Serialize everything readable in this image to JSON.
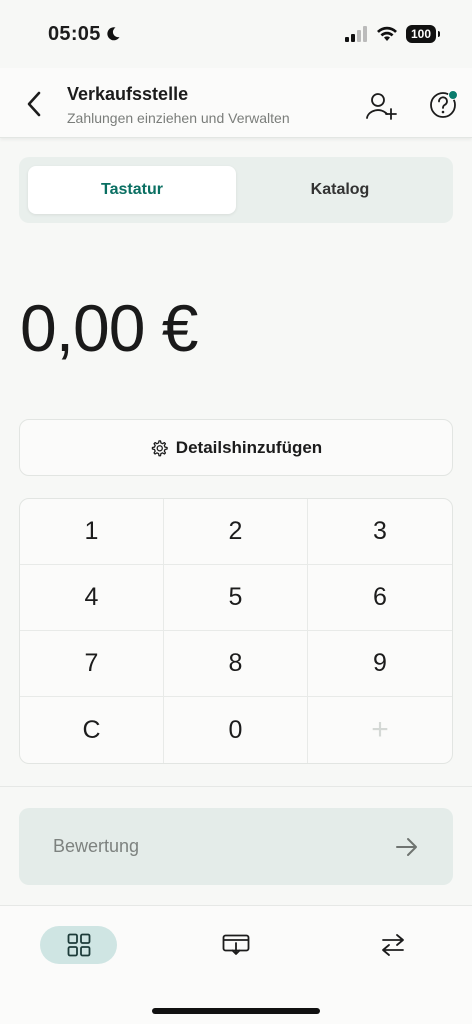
{
  "status_bar": {
    "time": "05:05",
    "battery": "100",
    "icons": [
      "moon-icon",
      "cellular-signal-icon",
      "wifi-icon",
      "battery-icon"
    ]
  },
  "header": {
    "title": "Verkaufsstelle",
    "subtitle": "Zahlungen einziehen und Verwalten",
    "icons": [
      "back-chevron-icon",
      "add-user-icon",
      "help-icon"
    ]
  },
  "tabs": {
    "items": [
      {
        "label": "Tastatur",
        "active": true
      },
      {
        "label": "Katalog",
        "active": false
      }
    ]
  },
  "amount": "0,00 €",
  "details_button": {
    "label": "Detailshinzufügen",
    "icon": "gear-icon"
  },
  "keypad": {
    "keys": [
      "1",
      "2",
      "3",
      "4",
      "5",
      "6",
      "7",
      "8",
      "9",
      "C",
      "0",
      "+"
    ]
  },
  "submit_button": {
    "label": "Bewertung",
    "icon": "arrow-right-icon"
  },
  "bottom_nav": {
    "items": [
      {
        "icon": "grid-icon",
        "active": true
      },
      {
        "icon": "card-reader-icon",
        "active": false
      },
      {
        "icon": "transfer-arrows-icon",
        "active": false
      }
    ]
  },
  "colors": {
    "accent": "#0a6f62",
    "notification_dot": "#0a7c6d",
    "segment_bg": "#e9efec",
    "submit_bg": "#e4ece9",
    "active_nav_bg": "#cfe5e3"
  }
}
